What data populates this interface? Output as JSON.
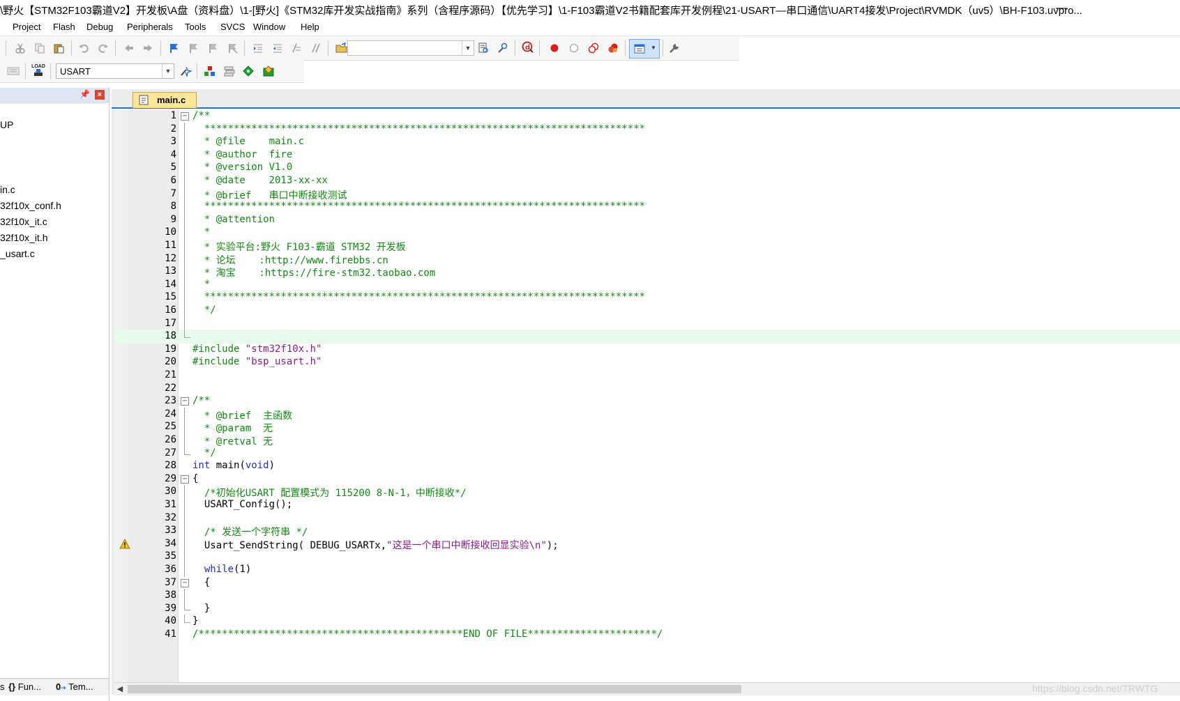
{
  "window": {
    "title": "\\野火【STM32F103霸道V2】开发板\\A盘（资料盘）\\1-[野火]《STM32库开发实战指南》系列（含程序源码）【优先学习】\\1-F103霸道V2书籍配套库开发例程\\21-USART—串口通信\\UART4接发\\Project\\RVMDK（uv5）\\BH-F103.uvpro...",
    "minimize_glyph": "—"
  },
  "menu": [
    {
      "label": "Project"
    },
    {
      "label": "Flash"
    },
    {
      "label": "Debug"
    },
    {
      "label": "Peripherals"
    },
    {
      "label": "Tools"
    },
    {
      "label": "SVCS"
    },
    {
      "label": "Window"
    },
    {
      "label": "Help"
    }
  ],
  "toolbar2": {
    "target_value": "USART",
    "load_label": "LOAD"
  },
  "left_panel": {
    "items": [
      "UP",
      "in.c",
      "32f10x_conf.h",
      "32f10x_it.c",
      "32f10x_it.h",
      "_usart.c"
    ],
    "tabs": [
      "s",
      "Fun...",
      "Tem..."
    ],
    "func_glyph": "{}",
    "tmpl_glyph": "0"
  },
  "editor": {
    "file_tab": "main.c",
    "lines": [
      [
        {
          "t": "c",
          "v": "/**"
        }
      ],
      [
        {
          "t": "c",
          "v": "  ***************************************************************************"
        }
      ],
      [
        {
          "t": "c",
          "v": "  * @file    main.c"
        }
      ],
      [
        {
          "t": "c",
          "v": "  * @author  fire"
        }
      ],
      [
        {
          "t": "c",
          "v": "  * @version V1.0"
        }
      ],
      [
        {
          "t": "c",
          "v": "  * @date    2013-xx-xx"
        }
      ],
      [
        {
          "t": "c",
          "v": "  * @brief   串口中断接收测试"
        }
      ],
      [
        {
          "t": "c",
          "v": "  ***************************************************************************"
        }
      ],
      [
        {
          "t": "c",
          "v": "  * @attention"
        }
      ],
      [
        {
          "t": "c",
          "v": "  *"
        }
      ],
      [
        {
          "t": "c",
          "v": "  * 实验平台:野火 F103-霸道 STM32 开发板"
        }
      ],
      [
        {
          "t": "c",
          "v": "  * 论坛    :http://www.firebbs.cn"
        }
      ],
      [
        {
          "t": "c",
          "v": "  * 淘宝    :https://fire-stm32.taobao.com"
        }
      ],
      [
        {
          "t": "c",
          "v": "  *"
        }
      ],
      [
        {
          "t": "c",
          "v": "  ***************************************************************************"
        }
      ],
      [
        {
          "t": "c",
          "v": "  */"
        }
      ],
      [],
      [],
      [
        {
          "t": "pp",
          "v": "#include "
        },
        {
          "t": "s",
          "v": "\"stm32f10x.h\""
        }
      ],
      [
        {
          "t": "pp",
          "v": "#include "
        },
        {
          "t": "s",
          "v": "\"bsp_usart.h\""
        }
      ],
      [],
      [],
      [
        {
          "t": "c",
          "v": "/**"
        }
      ],
      [
        {
          "t": "c",
          "v": "  * @brief  主函数"
        }
      ],
      [
        {
          "t": "c",
          "v": "  * @param  无"
        }
      ],
      [
        {
          "t": "c",
          "v": "  * @retval 无"
        }
      ],
      [
        {
          "t": "c",
          "v": "  */"
        }
      ],
      [
        {
          "t": "k",
          "v": "int"
        },
        {
          "t": "p",
          "v": " main("
        },
        {
          "t": "k",
          "v": "void"
        },
        {
          "t": "p",
          "v": ")"
        }
      ],
      [
        {
          "t": "p",
          "v": "{"
        }
      ],
      [
        {
          "t": "c",
          "v": "  /*初始化USART 配置模式为 115200 8-N-1，中断接收*/"
        }
      ],
      [
        {
          "t": "p",
          "v": "  USART_Config();"
        }
      ],
      [],
      [
        {
          "t": "c",
          "v": "  /* 发送一个字符串 */"
        }
      ],
      [
        {
          "t": "p",
          "v": "  Usart_SendString( DEBUG_USARTx,"
        },
        {
          "t": "s",
          "v": "\"这是一个串口中断接收回显实验\\n\""
        },
        {
          "t": "p",
          "v": ");"
        }
      ],
      [],
      [
        {
          "t": "p",
          "v": "  "
        },
        {
          "t": "k",
          "v": "while"
        },
        {
          "t": "p",
          "v": "(1)"
        }
      ],
      [
        {
          "t": "p",
          "v": "  {"
        }
      ],
      [],
      [
        {
          "t": "p",
          "v": "  }"
        }
      ],
      [
        {
          "t": "p",
          "v": "}"
        }
      ],
      [
        {
          "t": "c",
          "v": "/*********************************************END OF FILE**********************/"
        }
      ]
    ]
  },
  "watermark": "https://blog.csdn.net/TRWTG",
  "colors": {
    "comment": "#108a10",
    "keyword": "#1e2fd1",
    "string": "#8a1c8a",
    "current_line": "#e8fae9",
    "tab": "#fde59a",
    "tab_underline": "#2a6ecf"
  }
}
